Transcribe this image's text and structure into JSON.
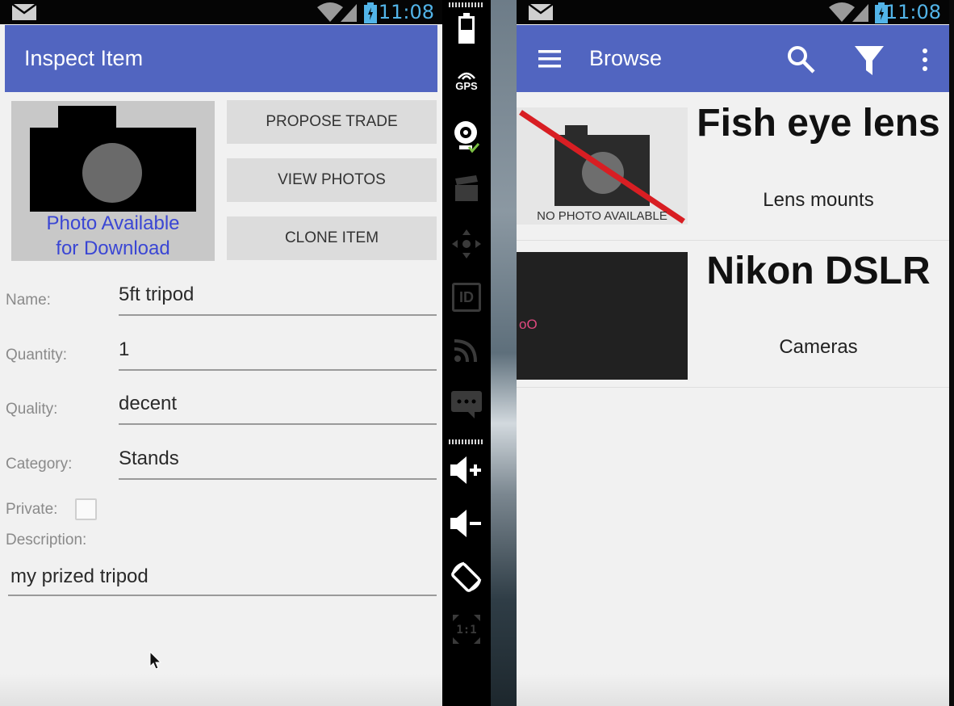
{
  "status_bar": {
    "time": "11:08"
  },
  "inspect": {
    "title": "Inspect Item",
    "photo_caption_line1": "Photo Available",
    "photo_caption_line2": "for Download",
    "buttons": {
      "propose": "PROPOSE TRADE",
      "view_photos": "VIEW PHOTOS",
      "clone": "CLONE ITEM"
    },
    "fields": {
      "name_label": "Name:",
      "name_value": "5ft tripod",
      "quantity_label": "Quantity:",
      "quantity_value": "1",
      "quality_label": "Quality:",
      "quality_value": "decent",
      "category_label": "Category:",
      "category_value": "Stands",
      "private_label": "Private:",
      "private_checked": false,
      "description_label": "Description:",
      "description_value": "my prized tripod"
    }
  },
  "emulator_toolbar": {
    "icons": [
      "battery-icon",
      "gps-icon",
      "webcam-icon",
      "media-icon",
      "dpad-icon",
      "device-id-icon",
      "network-icon",
      "sms-icon",
      "volume-up-icon",
      "volume-down-icon",
      "rotate-icon",
      "scale-icon"
    ],
    "gps_label": "GPS",
    "id_label": "ID",
    "scale_label": "1:1"
  },
  "browse": {
    "title": "Browse",
    "items": [
      {
        "name": "Fish eye lens",
        "category": "Lens mounts",
        "no_photo_text": "NO PHOTO AVAILABLE"
      },
      {
        "name": "Nikon DSLR",
        "category": "Cameras",
        "thumb_mark": "oO"
      }
    ]
  },
  "colors": {
    "appbar": "#5165c0",
    "accent_link": "#3a46d4",
    "status_time": "#52b4e8",
    "no_photo_slash": "#d81e23"
  }
}
